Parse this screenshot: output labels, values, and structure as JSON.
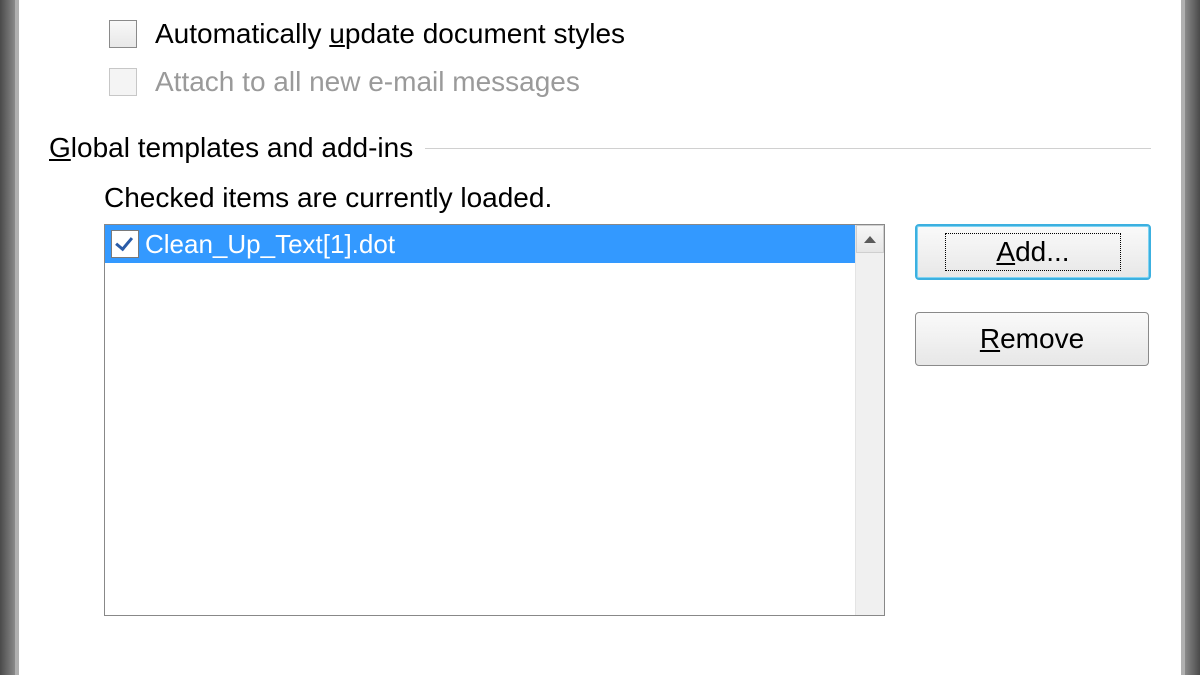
{
  "checkboxes": {
    "auto_update_label": "Automatically update document styles",
    "attach_email_label": "Attach to all new e-mail messages"
  },
  "section": {
    "title": "Global templates and add-ins",
    "help": "Checked items are currently loaded."
  },
  "list": {
    "items": [
      {
        "label": "Clean_Up_Text[1].dot",
        "checked": true,
        "selected": true
      }
    ]
  },
  "buttons": {
    "add": "Add...",
    "remove": "Remove"
  }
}
